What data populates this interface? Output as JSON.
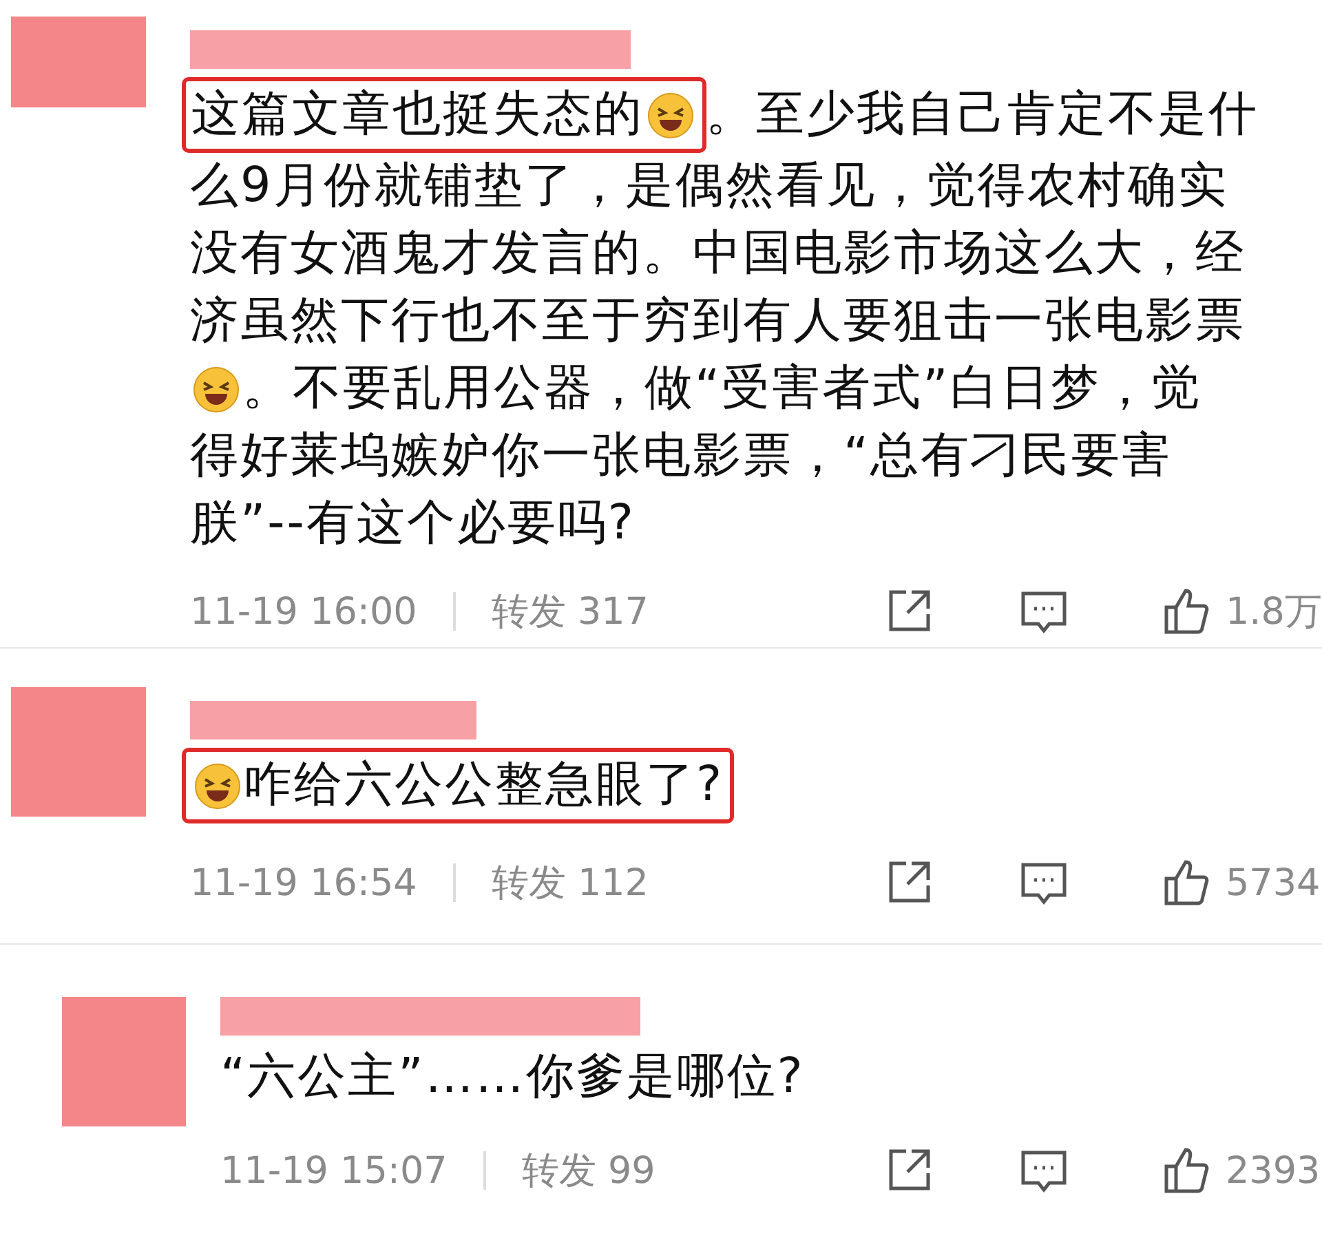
{
  "comments": [
    {
      "lines": [
        [
          {
            "kind": "highlight",
            "parts": [
              {
                "kind": "text",
                "text": "这篇文章也挺失态的"
              },
              {
                "kind": "emoji"
              }
            ]
          },
          {
            "kind": "text",
            "text": "。至少我自己肯定不是什"
          }
        ],
        [
          {
            "kind": "text",
            "text": "么9月份就铺垫了，是偶然看见，觉得农村确实"
          }
        ],
        [
          {
            "kind": "text",
            "text": "没有女酒鬼才发言的。中国电影市场这么大，经"
          }
        ],
        [
          {
            "kind": "text",
            "text": "济虽然下行也不至于穷到有人要狙击一张电影票"
          }
        ],
        [
          {
            "kind": "emoji"
          },
          {
            "kind": "text",
            "text": "。不要乱用公器，做“受害者式”白日梦，觉"
          }
        ],
        [
          {
            "kind": "text",
            "text": "得好莱坞嫉妒你一张电影票，“总有刁民要害"
          }
        ],
        [
          {
            "kind": "text",
            "text": "朕”--有这个必要吗?"
          }
        ]
      ],
      "time": "11-19 16:00",
      "repost": "转发 317",
      "likes": "1.8万"
    },
    {
      "lines": [
        [
          {
            "kind": "highlight",
            "parts": [
              {
                "kind": "emoji"
              },
              {
                "kind": "text",
                "text": "咋给六公公整急眼了?"
              }
            ]
          }
        ]
      ],
      "time": "11-19 16:54",
      "repost": "转发 112",
      "likes": "5734"
    },
    {
      "lines": [
        [
          {
            "kind": "text",
            "text": "“六公主”……你爹是哪位?"
          }
        ]
      ],
      "time": "11-19 15:07",
      "repost": "转发 99",
      "likes": "2393"
    }
  ]
}
